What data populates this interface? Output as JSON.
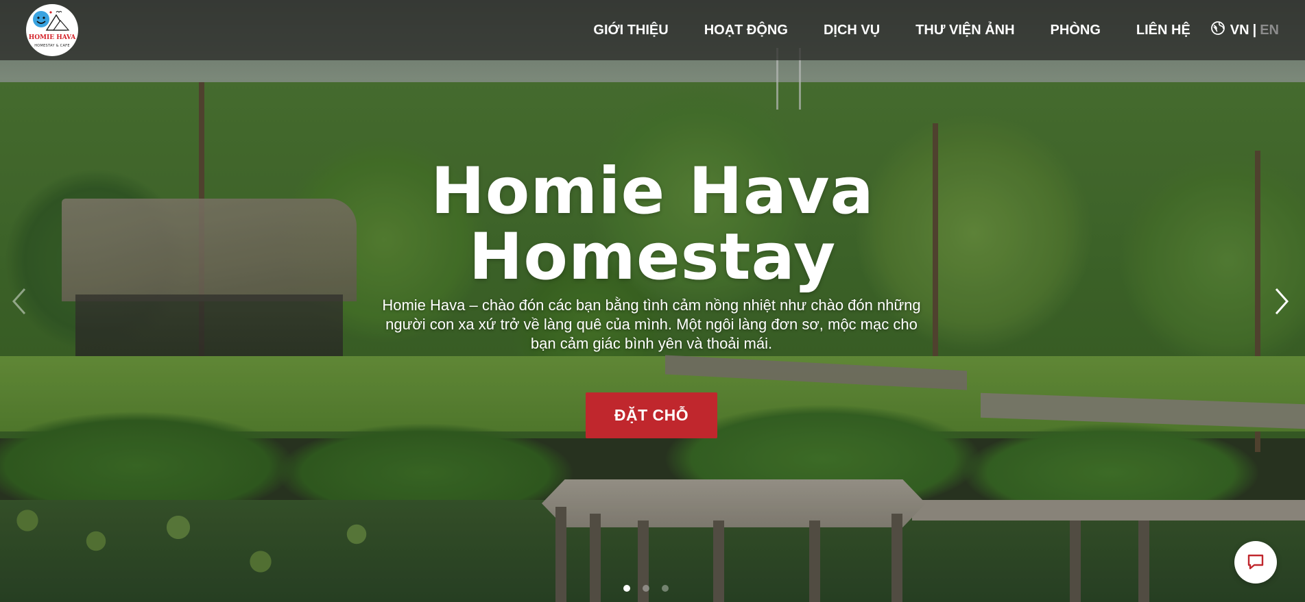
{
  "logo": {
    "name": "HOMIE HAVA",
    "tagline": "HOMESTAY & CAFE",
    "icon": "smiling-globe-mountain-logo"
  },
  "nav": {
    "items": [
      {
        "label": "GIỚI THIỆU"
      },
      {
        "label": "HOẠT ĐỘNG"
      },
      {
        "label": "DỊCH VỤ"
      },
      {
        "label": "THƯ VIỆN ẢNH"
      },
      {
        "label": "PHÒNG"
      },
      {
        "label": "LIÊN HỆ"
      }
    ],
    "language": {
      "icon": "globe-icon",
      "active": "VN",
      "separator": "|",
      "inactive": "EN"
    }
  },
  "hero": {
    "title_line1": "Homie Hava",
    "title_line2": "Homestay",
    "description_line1": "Homie Hava – chào đón các bạn bằng tình cảm nồng nhiệt như chào đón những",
    "description_line2": "người con xa xứ trở về làng quê của mình. Một ngôi làng đơn sơ, mộc mạc cho",
    "description_line3": "bạn cảm giác bình yên và thoải mái.",
    "cta_label": "ĐẶT CHỖ"
  },
  "carousel": {
    "prev_icon": "chevron-left-icon",
    "next_icon": "chevron-right-icon",
    "slides": 3,
    "active_slide": 1
  },
  "chat": {
    "icon": "chat-bubble-icon"
  },
  "colors": {
    "accent": "#c0272d",
    "nav_bg": "#262622",
    "text": "#ffffff",
    "inactive_lang": "#8c8c8c"
  }
}
